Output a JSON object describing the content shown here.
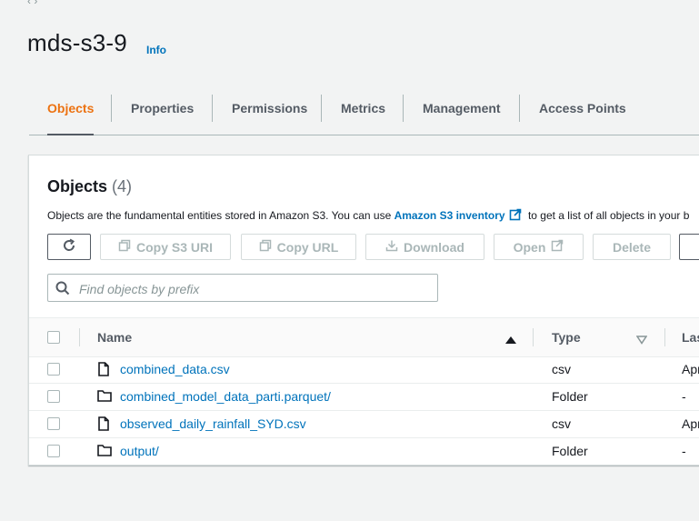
{
  "header": {
    "bucket_name": "mds-s3-9",
    "info_label": "Info"
  },
  "tabs": [
    {
      "label": "Objects",
      "active": true
    },
    {
      "label": "Properties",
      "active": false
    },
    {
      "label": "Permissions",
      "active": false
    },
    {
      "label": "Metrics",
      "active": false
    },
    {
      "label": "Management",
      "active": false
    },
    {
      "label": "Access Points",
      "active": false
    }
  ],
  "objects_panel": {
    "title": "Objects",
    "count": "(4)",
    "description_before": "Objects are the fundamental entities stored in Amazon S3. You can use ",
    "inventory_link": "Amazon S3 inventory",
    "description_after": " to get a list of all objects in your b"
  },
  "toolbar": {
    "refresh_icon": "refresh-icon",
    "copy_s3_uri": "Copy S3 URI",
    "copy_url": "Copy URL",
    "download": "Download",
    "open": "Open",
    "delete": "Delete"
  },
  "search": {
    "placeholder": "Find objects by prefix",
    "value": ""
  },
  "table": {
    "columns": [
      "Name",
      "Type",
      "Las"
    ],
    "rows": [
      {
        "name": "combined_data.csv",
        "type": "csv",
        "last_modified": "Apr",
        "icon": "file-icon"
      },
      {
        "name": "combined_model_data_parti.parquet/",
        "type": "Folder",
        "last_modified": "-",
        "icon": "folder-icon"
      },
      {
        "name": "observed_daily_rainfall_SYD.csv",
        "type": "csv",
        "last_modified": "Apr",
        "icon": "file-icon"
      },
      {
        "name": "output/",
        "type": "Folder",
        "last_modified": "-",
        "icon": "folder-icon"
      }
    ]
  },
  "colors": {
    "accent": "#ec7211",
    "link": "#0073bb",
    "background": "#f2f3f3"
  }
}
